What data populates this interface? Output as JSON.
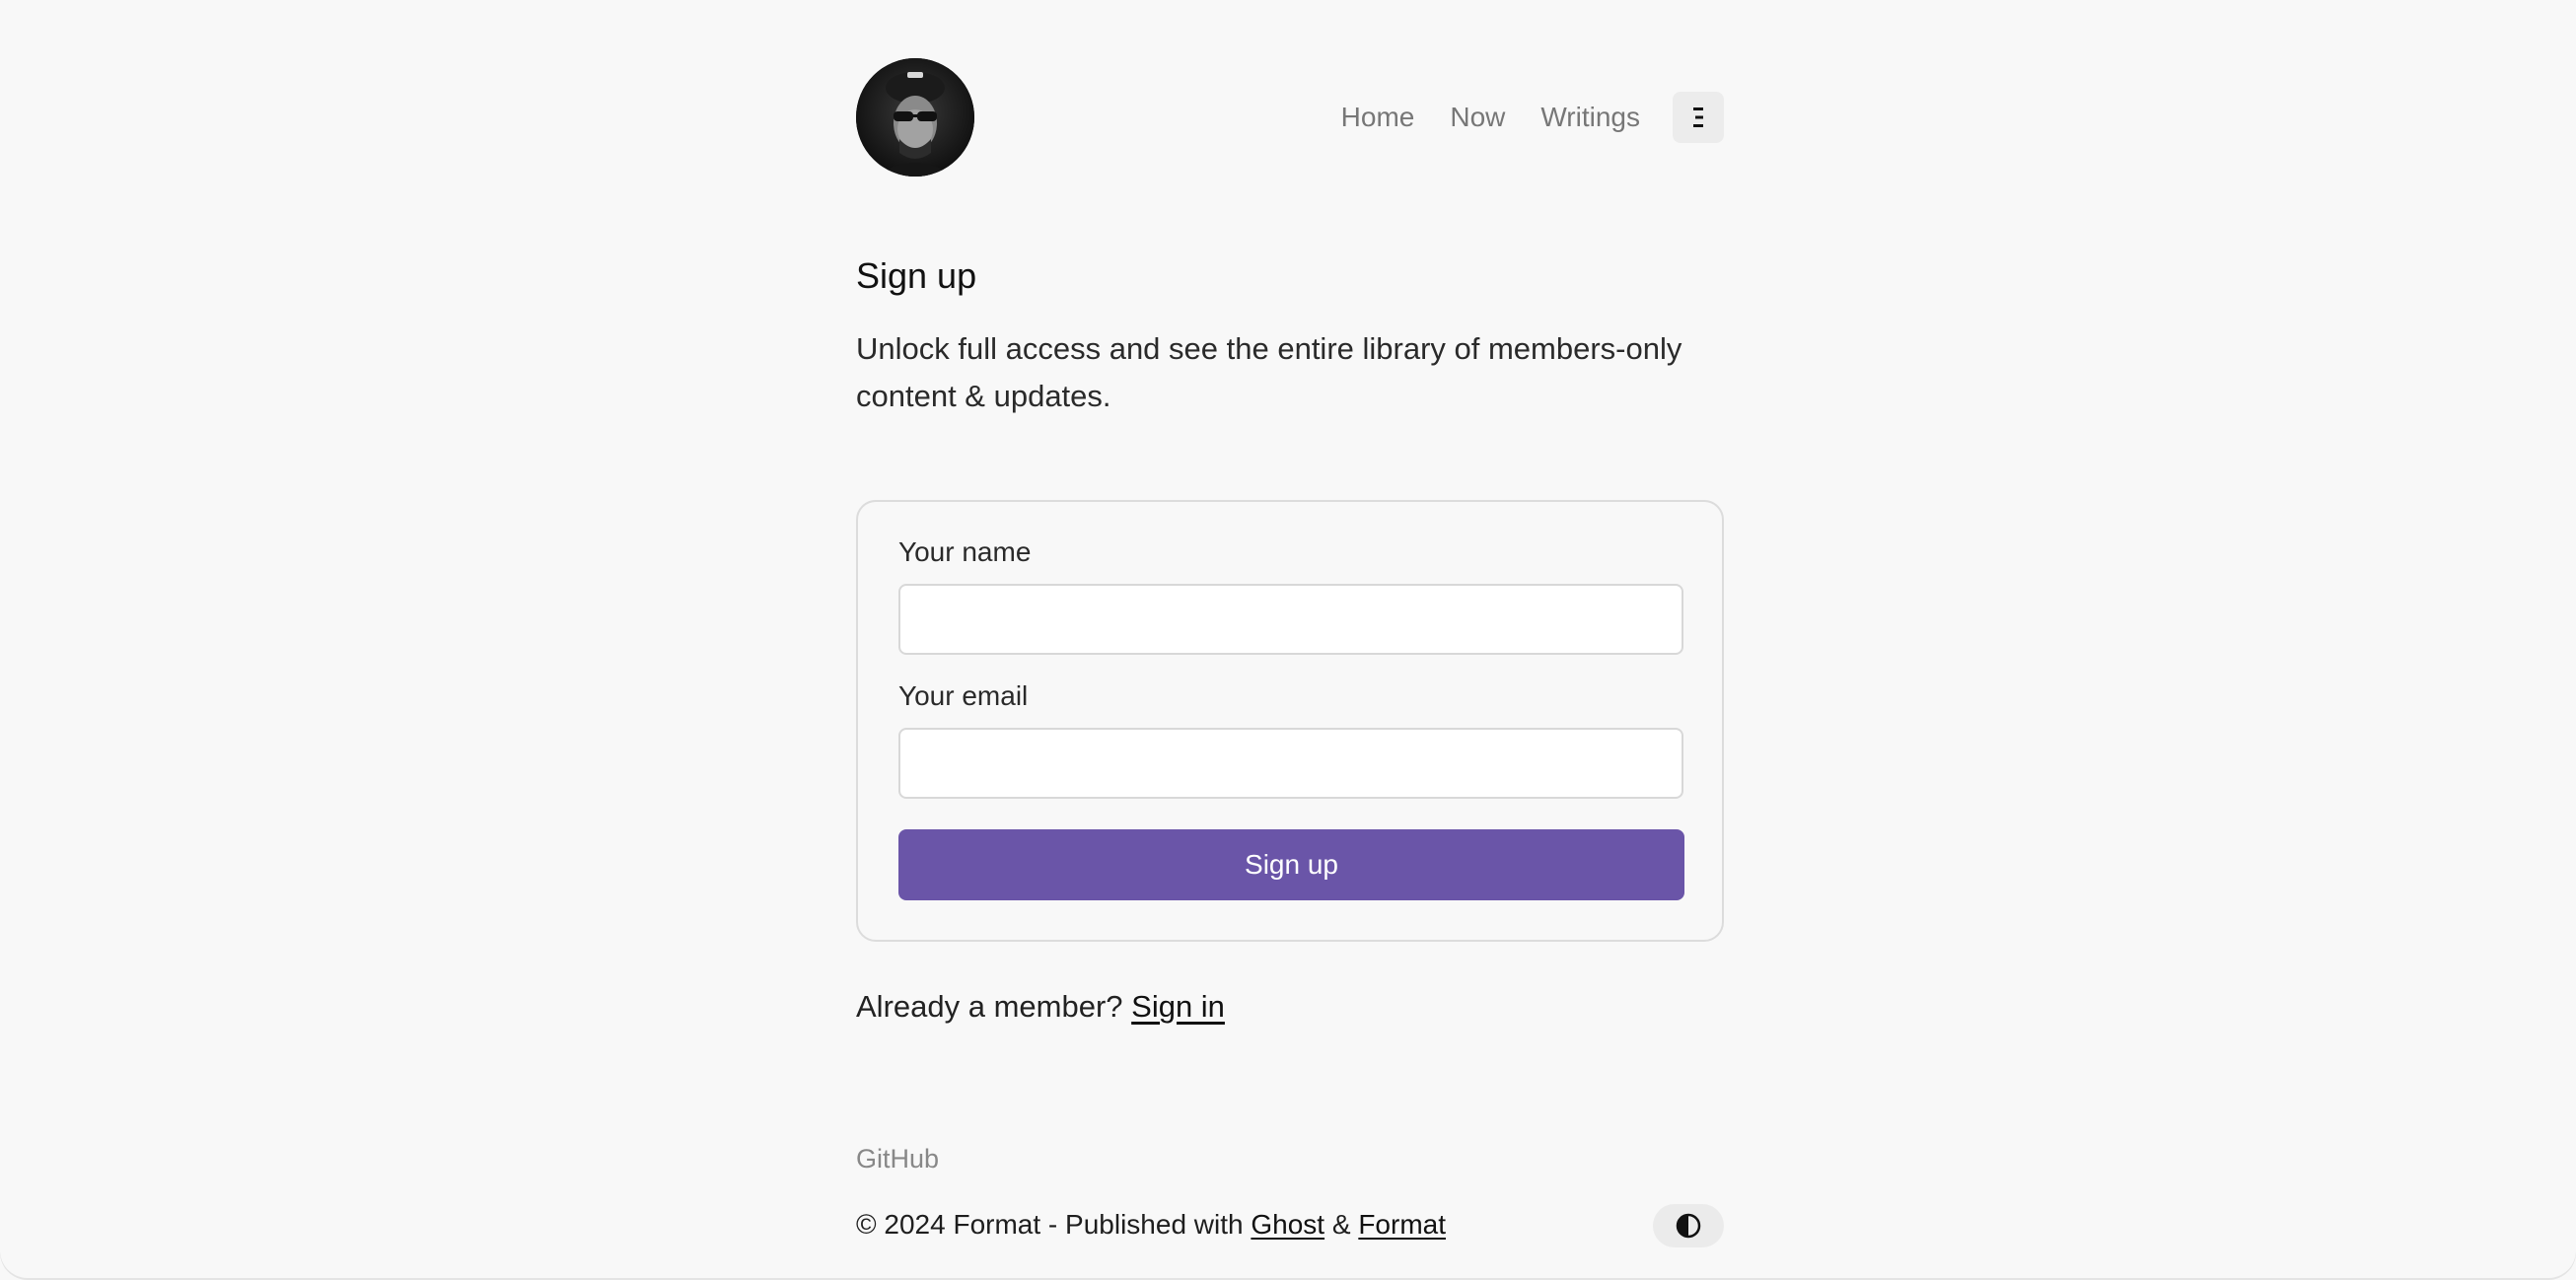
{
  "header": {
    "nav": [
      {
        "label": "Home"
      },
      {
        "label": "Now"
      },
      {
        "label": "Writings"
      }
    ],
    "menu_icon": "hamburger-menu-icon",
    "avatar_icon": "avatar-portrait-icon"
  },
  "main": {
    "title": "Sign up",
    "description": "Unlock full access and see the entire library of members-only content & updates."
  },
  "form": {
    "name_label": "Your name",
    "name_value": "",
    "email_label": "Your email",
    "email_value": "",
    "submit_label": "Sign up"
  },
  "member_prompt": {
    "text": "Already a member?",
    "link": "Sign in"
  },
  "footer": {
    "github": "GitHub",
    "copyright_prefix": "© 2024 Format - Published with",
    "ghost_link": "Ghost",
    "amp": "&",
    "format_link": "Format",
    "theme_icon": "contrast-toggle-icon"
  },
  "colors": {
    "accent": "#6a55a8",
    "background": "#f8f8f8"
  }
}
